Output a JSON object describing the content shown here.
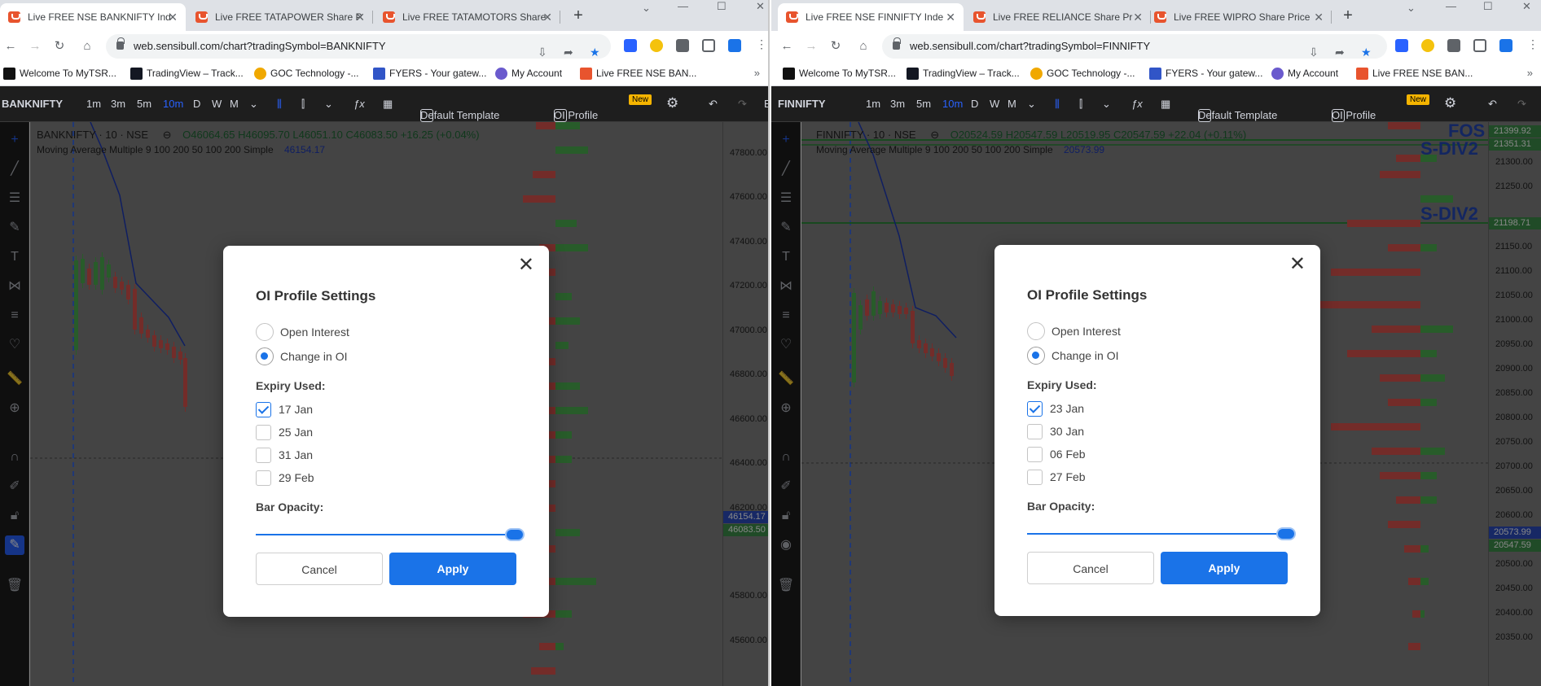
{
  "left": {
    "tabs": [
      {
        "label": "Live FREE NSE BANKNIFTY Ind"
      },
      {
        "label": "Live FREE TATAPOWER Share P"
      },
      {
        "label": "Live FREE TATAMOTORS Share"
      }
    ],
    "url": "web.sensibull.com/chart?tradingSymbol=BANKNIFTY",
    "bookmarks": [
      "Welcome To MyTSR...",
      "TradingView – Track...",
      "GOC Technology -...",
      "FYERS - Your gatew...",
      "My Account",
      "Live FREE NSE BAN..."
    ],
    "symbol": "BANKNIFTY",
    "timeframes": [
      "1m",
      "3m",
      "5m",
      "10m",
      "D",
      "W",
      "M"
    ],
    "template_label": "Default Template",
    "oi_profile_label": "OI Profile",
    "new_badge": "New",
    "chart_title": "BANKNIFTY · 10 · NSE",
    "ohlc": {
      "o": "O46064.65",
      "h": "H46095.70",
      "l": "L46051.10",
      "c": "C46083.50",
      "chg": "+16.25 (+0.04%)"
    },
    "ma_label": "Moving Average Multiple 9 100 200 50 100 200 Simple",
    "ma_value": "46154.17",
    "price_ticks": [
      "47800.00",
      "47600.00",
      "47400.00",
      "47200.00",
      "47000.00",
      "46800.00",
      "46600.00",
      "46400.00",
      "46200.00",
      "46000.00",
      "45800.00",
      "45600.00"
    ],
    "price_tag_ma": "46154.17",
    "price_tag_last": "46083.50",
    "axis_cut": "E",
    "modal": {
      "title": "OI Profile Settings",
      "radio_open_interest": "Open Interest",
      "radio_change_oi": "Change in OI",
      "expiry_label": "Expiry Used:",
      "expiries": [
        "17 Jan",
        "25 Jan",
        "31 Jan",
        "29 Feb"
      ],
      "expiry_checked": [
        true,
        false,
        false,
        false
      ],
      "opacity_label": "Bar Opacity:",
      "opacity_value": 1.0,
      "cancel": "Cancel",
      "apply": "Apply"
    }
  },
  "right": {
    "tabs": [
      {
        "label": "Live FREE NSE FINNIFTY Inde"
      },
      {
        "label": "Live FREE RELIANCE Share Pr"
      },
      {
        "label": "Live FREE WIPRO Share Price"
      }
    ],
    "url": "web.sensibull.com/chart?tradingSymbol=FINNIFTY",
    "bookmarks": [
      "Welcome To MyTSR...",
      "TradingView – Track...",
      "GOC Technology -...",
      "FYERS - Your gatew...",
      "My Account",
      "Live FREE NSE BAN..."
    ],
    "symbol": "FINNIFTY",
    "timeframes": [
      "1m",
      "3m",
      "5m",
      "10m",
      "D",
      "W",
      "M"
    ],
    "template_label": "Default Template",
    "oi_profile_label": "OI Profile",
    "new_badge": "New",
    "chart_title": "FINNIFTY · 10 · NSE",
    "ohlc": {
      "o": "O20524.59",
      "h": "H20547.59",
      "l": "L20519.95",
      "c": "C20547.59",
      "chg": "+22.04 (+0.11%)"
    },
    "ma_label": "Moving Average Multiple 9 100 200 50 100 200 Simple",
    "ma_value": "20573.99",
    "annotations": [
      "FOS",
      "S-DIV2",
      "S-DIV2"
    ],
    "price_ticks": [
      "21300.00",
      "21250.00",
      "21150.00",
      "21100.00",
      "21050.00",
      "21000.00",
      "20950.00",
      "20900.00",
      "20850.00",
      "20800.00",
      "20750.00",
      "20700.00",
      "20650.00",
      "20600.00",
      "20500.00",
      "20450.00",
      "20400.00",
      "20350.00"
    ],
    "price_tags": {
      "t1": "21399.92",
      "t2": "21351.31",
      "t3": "21198.71",
      "ma": "20573.99",
      "last": "20547.59"
    },
    "modal": {
      "title": "OI Profile Settings",
      "radio_open_interest": "Open Interest",
      "radio_change_oi": "Change in OI",
      "expiry_label": "Expiry Used:",
      "expiries": [
        "23 Jan",
        "30 Jan",
        "06 Feb",
        "27 Feb"
      ],
      "expiry_checked": [
        true,
        false,
        false,
        false
      ],
      "opacity_label": "Bar Opacity:",
      "opacity_value": 1.0,
      "cancel": "Cancel",
      "apply": "Apply"
    }
  },
  "colors": {
    "accent": "#1a73e8",
    "up": "#4caf50",
    "down": "#d9534f",
    "ma_line": "#1e3ab8",
    "tradingview_blue": "#2962ff"
  }
}
